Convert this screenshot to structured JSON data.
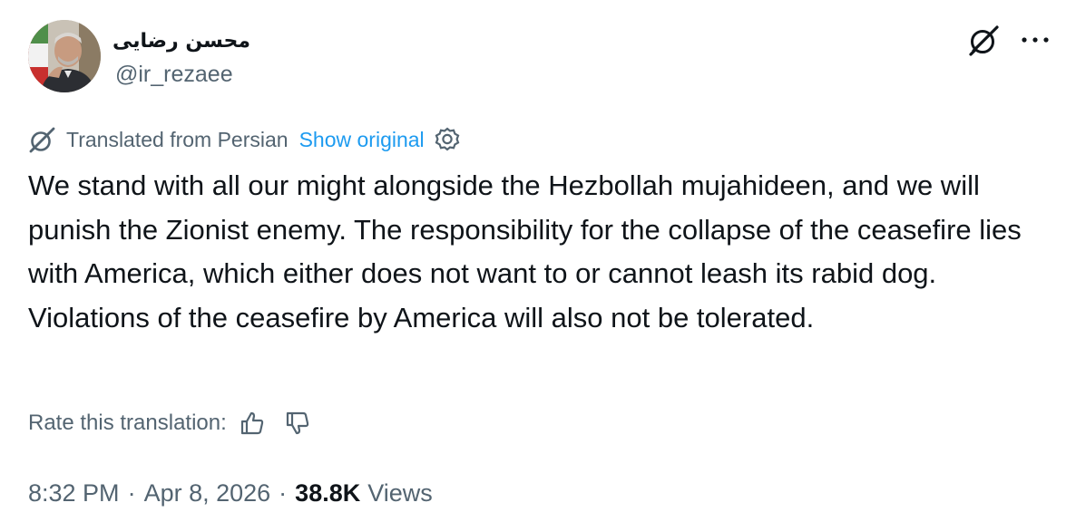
{
  "author": {
    "display_name": "محسن رضایی",
    "handle": "@ir_rezaee",
    "avatar_icon": "profile-photo"
  },
  "header_actions": {
    "grok_icon": "grok-icon",
    "more_icon": "more-icon"
  },
  "translation": {
    "label": "Translated from Persian",
    "show_original": "Show original",
    "settings_icon": "settings-icon",
    "source_icon": "grok-icon"
  },
  "tweet": {
    "text": "We stand with all our might alongside the Hezbollah mujahideen, and we will punish the Zionist enemy. The responsibility for the collapse of the ceasefire lies with America, which either does not want to or cannot leash its rabid dog. Violations of the ceasefire by America will also not be tolerated."
  },
  "rating": {
    "label": "Rate this translation:",
    "up_icon": "thumbs-up-icon",
    "down_icon": "thumbs-down-icon"
  },
  "meta": {
    "time": "8:32 PM",
    "separator": "·",
    "date": "Apr 8, 2026",
    "views_count": "38.8K",
    "views_label": "Views"
  },
  "colors": {
    "text_primary": "#0f1419",
    "text_secondary": "#536471",
    "link": "#1d9bf0",
    "background": "#ffffff"
  }
}
